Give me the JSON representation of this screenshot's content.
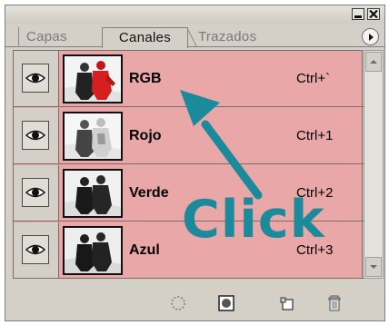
{
  "tabs": [
    {
      "label": "Capas",
      "active": false
    },
    {
      "label": "Canales",
      "active": true
    },
    {
      "label": "Trazados",
      "active": false
    }
  ],
  "channels": [
    {
      "name": "RGB",
      "shortcut": "Ctrl+`",
      "visible": true,
      "thumbnail": "color"
    },
    {
      "name": "Rojo",
      "shortcut": "Ctrl+1",
      "visible": true,
      "thumbnail": "grayscale-light"
    },
    {
      "name": "Verde",
      "shortcut": "Ctrl+2",
      "visible": true,
      "thumbnail": "grayscale-dark"
    },
    {
      "name": "Azul",
      "shortcut": "Ctrl+3",
      "visible": true,
      "thumbnail": "grayscale-dark"
    }
  ],
  "annotation": {
    "text": "Click",
    "color": "#1b8a9a"
  },
  "colors": {
    "selection_highlight": "#e9a7a7",
    "panel_bg": "#d4d0c8",
    "annotation": "#1b8a9a"
  },
  "footer_icons": [
    "load-selection-icon",
    "save-selection-icon",
    "new-channel-icon",
    "delete-icon"
  ]
}
